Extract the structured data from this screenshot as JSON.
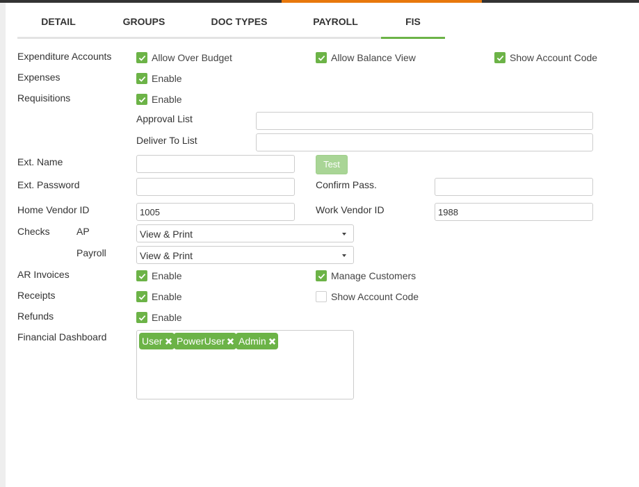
{
  "tabs": [
    {
      "label": "DETAIL"
    },
    {
      "label": "GROUPS"
    },
    {
      "label": "DOC TYPES"
    },
    {
      "label": "PAYROLL"
    },
    {
      "label": "FIS",
      "active": true
    }
  ],
  "colors": {
    "accent": "#6cb347",
    "top_accent": "#e8780c"
  },
  "form": {
    "expenditure": {
      "label": "Expenditure Accounts",
      "allow_over_budget": {
        "label": "Allow Over Budget",
        "checked": true
      },
      "allow_balance_view": {
        "label": "Allow Balance View",
        "checked": true
      },
      "show_account_code": {
        "label": "Show Account Code",
        "checked": true
      }
    },
    "expenses": {
      "label": "Expenses",
      "enable": {
        "label": "Enable",
        "checked": true
      }
    },
    "requisitions": {
      "label": "Requisitions",
      "enable": {
        "label": "Enable",
        "checked": true
      },
      "approval_list_label": "Approval List",
      "approval_list_value": "",
      "deliver_to_label": "Deliver To List",
      "deliver_to_value": ""
    },
    "ext_name": {
      "label": "Ext. Name",
      "value": "",
      "test_button": "Test"
    },
    "ext_password": {
      "label": "Ext. Password",
      "value": "",
      "confirm_label": "Confirm Pass.",
      "confirm_value": ""
    },
    "vendor": {
      "home_label": "Home Vendor ID",
      "home_value": "1005",
      "work_label": "Work Vendor ID",
      "work_value": "1988"
    },
    "checks": {
      "label": "Checks",
      "ap_label": "AP",
      "ap_value": "View & Print",
      "payroll_label": "Payroll",
      "payroll_value": "View & Print"
    },
    "ar_invoices": {
      "label": "AR Invoices",
      "enable": {
        "label": "Enable",
        "checked": true
      },
      "manage_customers": {
        "label": "Manage Customers",
        "checked": true
      }
    },
    "receipts": {
      "label": "Receipts",
      "enable": {
        "label": "Enable",
        "checked": true
      },
      "show_account_code": {
        "label": "Show Account Code",
        "checked": false
      }
    },
    "refunds": {
      "label": "Refunds",
      "enable": {
        "label": "Enable",
        "checked": true
      }
    },
    "financial_dashboard": {
      "label": "Financial Dashboard",
      "tags": [
        {
          "label": "User",
          "icon": "remove-icon"
        },
        {
          "label": "PowerUser",
          "icon": "remove-icon"
        },
        {
          "label": "Admin",
          "icon": "remove-icon"
        }
      ]
    }
  }
}
